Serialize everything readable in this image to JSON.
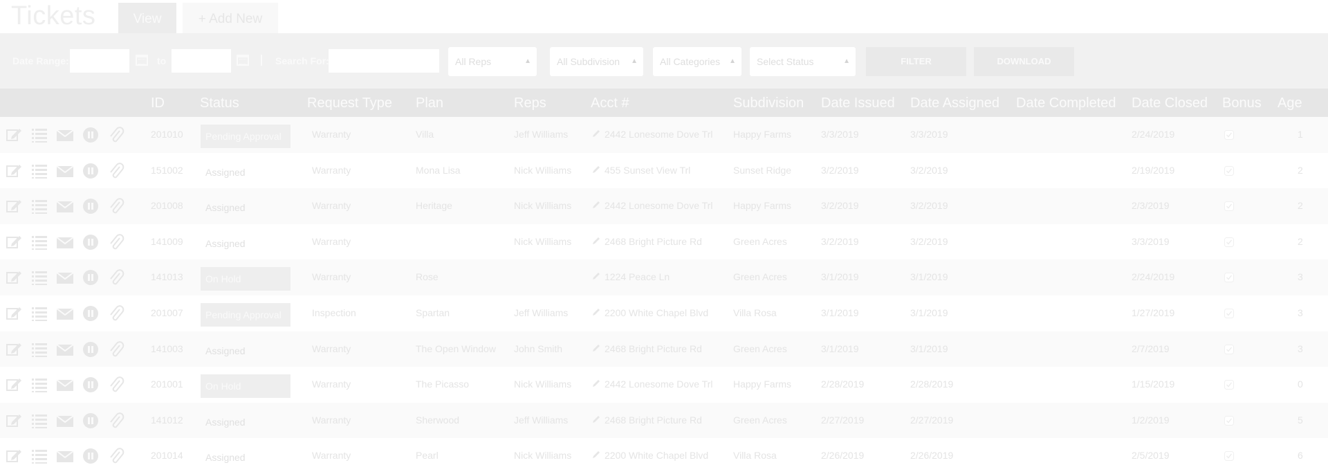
{
  "header": {
    "title": "Tickets",
    "tabs": [
      {
        "label": "View",
        "active": true
      },
      {
        "label": "+ Add New",
        "active": false
      }
    ]
  },
  "filters": {
    "date_range_label": "Date Range:",
    "to_label": "to",
    "date_from": "",
    "date_to": "",
    "search_label": "Search For:",
    "search_value": "",
    "reps_select": "All Reps",
    "subdivision_select": "All Subdivision",
    "categories_select": "All Categories",
    "status_select": "Select Status",
    "filter_button": "FILTER",
    "download_button": "DOWNLOAD"
  },
  "columns": [
    "ID",
    "Status",
    "Request Type",
    "Plan",
    "Reps",
    "Acct #",
    "Subdivision",
    "Date Issued",
    "Date Assigned",
    "Date Completed",
    "Date Closed",
    "Bonus",
    "Age"
  ],
  "icons": [
    "edit-icon",
    "list-icon",
    "envelope-icon",
    "pause-icon",
    "paperclip-icon"
  ],
  "rows": [
    {
      "id": "201010",
      "status": "Pending Approval",
      "status_shaded": true,
      "request_type": "Warranty",
      "plan": "Villa",
      "reps": "Jeff Williams",
      "acct": "2442 Lonesome Dove Trl",
      "subdivision": "Happy Farms",
      "date_issued": "3/3/2019",
      "date_assigned": "3/3/2019",
      "date_completed": "",
      "date_closed": "2/24/2019",
      "age": "1"
    },
    {
      "id": "151002",
      "status": "Assigned",
      "status_shaded": false,
      "request_type": "Warranty",
      "plan": "Mona Lisa",
      "reps": "Nick Williams",
      "acct": "455 Sunset View Trl",
      "subdivision": "Sunset Ridge",
      "date_issued": "3/2/2019",
      "date_assigned": "3/2/2019",
      "date_completed": "",
      "date_closed": "2/19/2019",
      "age": "2"
    },
    {
      "id": "201008",
      "status": "Assigned",
      "status_shaded": false,
      "request_type": "Warranty",
      "plan": "Heritage",
      "reps": "Nick Williams",
      "acct": "2442 Lonesome Dove Trl",
      "subdivision": "Happy Farms",
      "date_issued": "3/2/2019",
      "date_assigned": "3/2/2019",
      "date_completed": "",
      "date_closed": "2/3/2019",
      "age": "2"
    },
    {
      "id": "141009",
      "status": "Assigned",
      "status_shaded": false,
      "request_type": "Warranty",
      "plan": "",
      "reps": "Nick Williams",
      "acct": "2468 Bright Picture Rd",
      "subdivision": "Green Acres",
      "date_issued": "3/2/2019",
      "date_assigned": "3/2/2019",
      "date_completed": "",
      "date_closed": "3/3/2019",
      "age": "2"
    },
    {
      "id": "141013",
      "status": "On Hold",
      "status_shaded": true,
      "request_type": "Warranty",
      "plan": "Rose",
      "reps": "",
      "acct": "1224 Peace Ln",
      "subdivision": "Green Acres",
      "date_issued": "3/1/2019",
      "date_assigned": "3/1/2019",
      "date_completed": "",
      "date_closed": "2/24/2019",
      "age": "3"
    },
    {
      "id": "201007",
      "status": "Pending Approval",
      "status_shaded": true,
      "request_type": "Inspection",
      "plan": "Spartan",
      "reps": "Jeff Williams",
      "acct": "2200 White Chapel Blvd",
      "subdivision": "Villa Rosa",
      "date_issued": "3/1/2019",
      "date_assigned": "3/1/2019",
      "date_completed": "",
      "date_closed": "1/27/2019",
      "age": "3"
    },
    {
      "id": "141003",
      "status": "Assigned",
      "status_shaded": false,
      "request_type": "Warranty",
      "plan": "The Open Window",
      "reps": "John Smith",
      "acct": "2468 Bright Picture Rd",
      "subdivision": "Green Acres",
      "date_issued": "3/1/2019",
      "date_assigned": "3/1/2019",
      "date_completed": "",
      "date_closed": "2/7/2019",
      "age": "3"
    },
    {
      "id": "201001",
      "status": "On Hold",
      "status_shaded": true,
      "request_type": "Warranty",
      "plan": "The Picasso",
      "reps": "Nick Williams",
      "acct": "2442 Lonesome Dove Trl",
      "subdivision": "Happy Farms",
      "date_issued": "2/28/2019",
      "date_assigned": "2/28/2019",
      "date_completed": "",
      "date_closed": "1/15/2019",
      "age": "0"
    },
    {
      "id": "141012",
      "status": "Assigned",
      "status_shaded": false,
      "request_type": "Warranty",
      "plan": "Sherwood",
      "reps": "Jeff Williams",
      "acct": "2468 Bright Picture Rd",
      "subdivision": "Green Acres",
      "date_issued": "2/27/2019",
      "date_assigned": "2/27/2019",
      "date_completed": "",
      "date_closed": "1/2/2019",
      "age": "5"
    },
    {
      "id": "201014",
      "status": "Assigned",
      "status_shaded": false,
      "request_type": "Warranty",
      "plan": "Pearl",
      "reps": "Nick Williams",
      "acct": "2200 White Chapel Blvd",
      "subdivision": "Villa Rosa",
      "date_issued": "2/26/2019",
      "date_assigned": "2/26/2019",
      "date_completed": "",
      "date_closed": "2/5/2019",
      "age": "6"
    }
  ]
}
